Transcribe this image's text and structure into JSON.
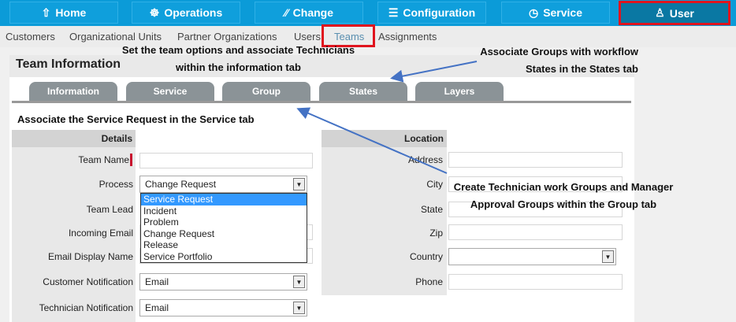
{
  "nav": [
    {
      "label": "Home",
      "icon": "home-icon"
    },
    {
      "label": "Operations",
      "icon": "wheel-icon"
    },
    {
      "label": "Change",
      "icon": "change-icon"
    },
    {
      "label": "Configuration",
      "icon": "sliders-icon"
    },
    {
      "label": "Service",
      "icon": "clock-icon"
    },
    {
      "label": "User",
      "icon": "user-icon"
    }
  ],
  "subnav": [
    "Customers",
    "Organizational Units",
    "Partner Organizations",
    "Users",
    "Teams",
    "Assignments"
  ],
  "panel_title": "Team Information",
  "tabs": [
    "Information",
    "Service",
    "Group",
    "States",
    "Layers"
  ],
  "annotations": {
    "info": "Set the team options and associate Technicians within the information tab",
    "states": "Associate Groups with workflow States in the States tab",
    "service": "Associate the Service Request in the Service tab",
    "group": "Create Technician work Groups and Manager Approval Groups within the Group tab"
  },
  "details": {
    "header": "Details",
    "team_name": "Team Name",
    "process": "Process",
    "process_value": "Change Request",
    "team_lead": "Team Lead",
    "incoming_email": "Incoming Email",
    "email_display": "Email Display Name",
    "customer_notification": "Customer Notification",
    "customer_notification_value": "Email",
    "technician_notification": "Technician Notification",
    "technician_notification_value": "Email"
  },
  "process_options": [
    "Service Request",
    "Incident",
    "Problem",
    "Change Request",
    "Release",
    "Service Portfolio"
  ],
  "location": {
    "header": "Location",
    "address": "Address",
    "city": "City",
    "state": "State",
    "zip": "Zip",
    "country": "Country",
    "phone": "Phone"
  }
}
